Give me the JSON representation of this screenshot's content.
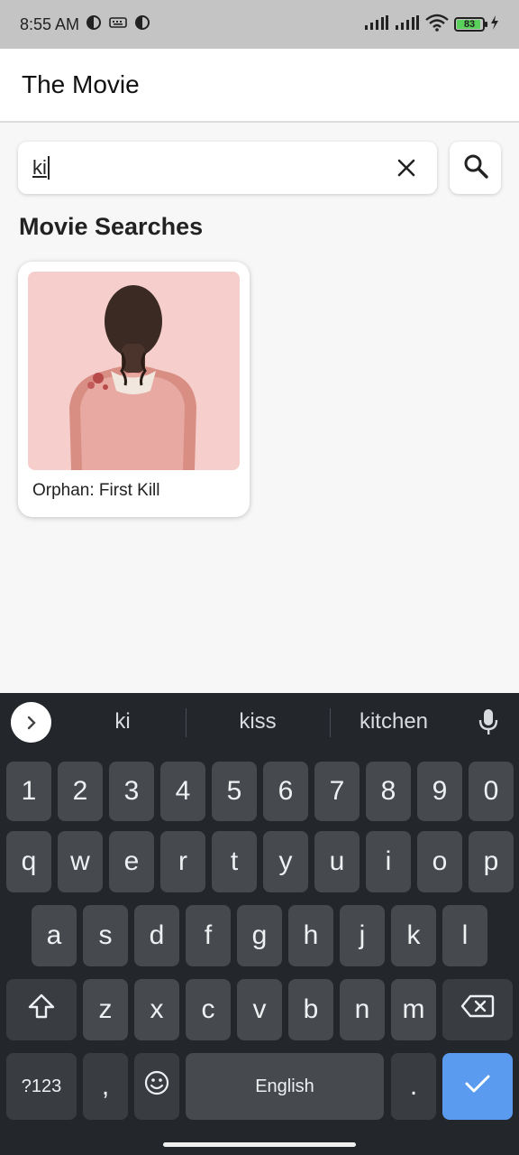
{
  "status": {
    "time": "8:55 AM",
    "battery": "83"
  },
  "app": {
    "title": "The Movie"
  },
  "search": {
    "value": "ki"
  },
  "section": {
    "title": "Movie Searches"
  },
  "movies": [
    {
      "title": "Orphan: First Kill"
    }
  ],
  "keyboard": {
    "suggestions": [
      "ki",
      "kiss",
      "kitchen"
    ],
    "row_numbers": [
      "1",
      "2",
      "3",
      "4",
      "5",
      "6",
      "7",
      "8",
      "9",
      "0"
    ],
    "row1": [
      "q",
      "w",
      "e",
      "r",
      "t",
      "y",
      "u",
      "i",
      "o",
      "p"
    ],
    "row2": [
      "a",
      "s",
      "d",
      "f",
      "g",
      "h",
      "j",
      "k",
      "l"
    ],
    "row3": [
      "z",
      "x",
      "c",
      "v",
      "b",
      "n",
      "m"
    ],
    "symbols_label": "?123",
    "comma": ",",
    "space_label": "English",
    "period": "."
  },
  "colors": {
    "accent": "#5b9bef",
    "keyboard_bg": "#23272b",
    "key_bg": "#464a4f"
  }
}
